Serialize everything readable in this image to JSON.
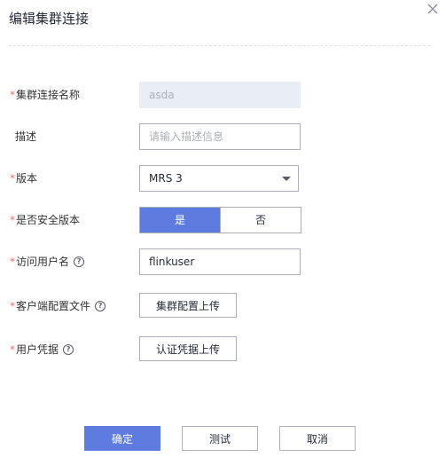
{
  "dialog": {
    "title": "编辑集群连接",
    "close_icon": "close-icon"
  },
  "form": {
    "required_mark": "*",
    "cluster_name": {
      "label": "集群连接名称",
      "value": "asda",
      "required": true,
      "disabled": true
    },
    "description": {
      "label": "描述",
      "value": "",
      "placeholder": "请输入描述信息"
    },
    "version": {
      "label": "版本",
      "selected": "MRS 3",
      "required": true
    },
    "secure_version": {
      "label": "是否安全版本",
      "options": [
        "是",
        "否"
      ],
      "selected": "是",
      "required": true
    },
    "username": {
      "label": "访问用户名",
      "value": "flinkuser",
      "required": true,
      "help_icon": "question-circle-icon",
      "help_glyph": "?"
    },
    "client_config": {
      "label": "客户端配置文件",
      "button": "集群配置上传",
      "required": true,
      "help_icon": "question-circle-icon",
      "help_glyph": "?"
    },
    "credentials": {
      "label": "用户凭据",
      "button": "认证凭据上传",
      "required": true,
      "help_icon": "question-circle-icon",
      "help_glyph": "?"
    }
  },
  "footer": {
    "confirm": "确定",
    "test": "测试",
    "cancel": "取消"
  },
  "colors": {
    "primary": "#5e7ce0",
    "required": "#f66f6a",
    "border": "#adb0b8",
    "disabled_bg": "#e9edf5"
  }
}
